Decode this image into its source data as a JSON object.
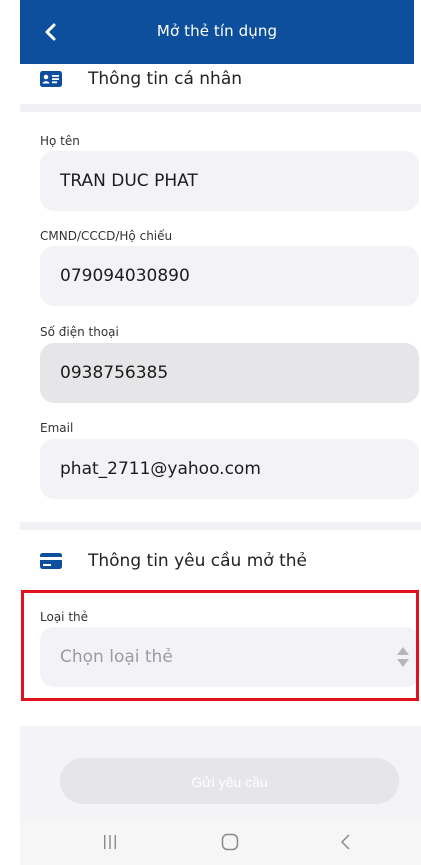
{
  "header": {
    "title": "Mở thẻ tín dụng"
  },
  "personal": {
    "section_title": "Thông tin cá nhân",
    "name_label": "Họ tên",
    "name_value": "TRAN DUC PHAT",
    "id_label": "CMND/CCCD/Hộ chiếu",
    "id_value": "079094030890",
    "phone_label": "Số điện thoại",
    "phone_value": "0938756385",
    "email_label": "Email",
    "email_value": "phat_2711@yahoo.com"
  },
  "request": {
    "section_title": "Thông tin yêu cầu mở thẻ",
    "card_type_label": "Loại thẻ",
    "card_type_placeholder": "Chọn loại thẻ"
  },
  "submit_label": "Gửi yêu cầu",
  "colors": {
    "header_bg": "#0d4f9c",
    "highlight": "#e0121e",
    "icon": "#0d4f9c"
  }
}
